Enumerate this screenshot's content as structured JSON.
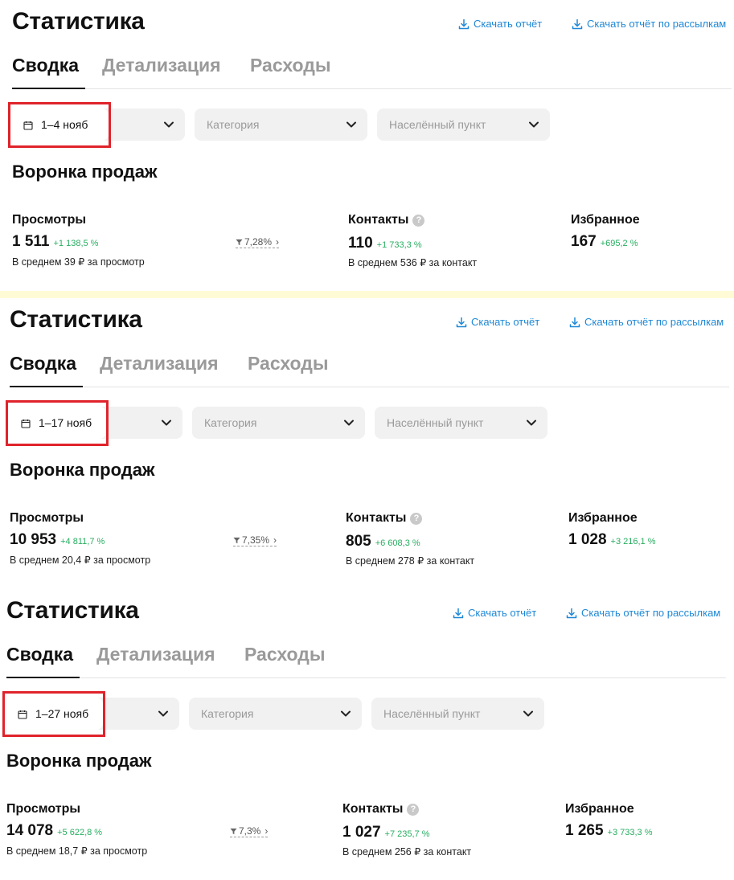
{
  "panels": [
    {
      "title": "Статистика",
      "download_report": "Скачать отчёт",
      "download_mailing_report": "Скачать отчёт по рассылкам",
      "tabs": [
        "Сводка",
        "Детализация",
        "Расходы"
      ],
      "active_tab": "Сводка",
      "date_range": "1–4 нояб",
      "category_placeholder": "Категория",
      "city_placeholder": "Населённый пункт",
      "section_title": "Воронка продаж",
      "views": {
        "label": "Просмотры",
        "value": "1 511",
        "delta": "+1 138,5 %",
        "sub": "В среднем 39 ₽ за просмотр"
      },
      "conversion": "7,28%",
      "contacts": {
        "label": "Контакты",
        "value": "110",
        "delta": "+1 733,3 %",
        "sub": "В среднем 536 ₽ за контакт"
      },
      "favorites": {
        "label": "Избранное",
        "value": "167",
        "delta": "+695,2 %"
      }
    },
    {
      "title": "Статистика",
      "download_report": "Скачать отчёт",
      "download_mailing_report": "Скачать отчёт по рассылкам",
      "tabs": [
        "Сводка",
        "Детализация",
        "Расходы"
      ],
      "active_tab": "Сводка",
      "date_range": "1–17 нояб",
      "category_placeholder": "Категория",
      "city_placeholder": "Населённый пункт",
      "section_title": "Воронка продаж",
      "views": {
        "label": "Просмотры",
        "value": "10 953",
        "delta": "+4 811,7 %",
        "sub": "В среднем 20,4 ₽ за просмотр"
      },
      "conversion": "7,35%",
      "contacts": {
        "label": "Контакты",
        "value": "805",
        "delta": "+6 608,3 %",
        "sub": "В среднем 278 ₽ за контакт"
      },
      "favorites": {
        "label": "Избранное",
        "value": "1 028",
        "delta": "+3 216,1 %"
      }
    },
    {
      "title": "Статистика",
      "download_report": "Скачать отчёт",
      "download_mailing_report": "Скачать отчёт по рассылкам",
      "tabs": [
        "Сводка",
        "Детализация",
        "Расходы"
      ],
      "active_tab": "Сводка",
      "date_range": "1–27 нояб",
      "category_placeholder": "Категория",
      "city_placeholder": "Населённый пункт",
      "section_title": "Воронка продаж",
      "views": {
        "label": "Просмотры",
        "value": "14 078",
        "delta": "+5 622,8 %",
        "sub": "В среднем 18,7 ₽ за просмотр"
      },
      "conversion": "7,3%",
      "contacts": {
        "label": "Контакты",
        "value": "1 027",
        "delta": "+7 235,7 %",
        "sub": "В среднем 256 ₽ за контакт"
      },
      "favorites": {
        "label": "Избранное",
        "value": "1 265",
        "delta": "+3 733,3 %"
      }
    }
  ],
  "colors": {
    "accent": "#1e88d6",
    "positive": "#27ae60",
    "highlight": "#e0232b",
    "divider": "#fffbd6"
  },
  "icons": [
    "download-icon",
    "calendar-icon",
    "chevron-down-icon",
    "question-icon",
    "funnel-icon",
    "chevron-right-icon"
  ]
}
